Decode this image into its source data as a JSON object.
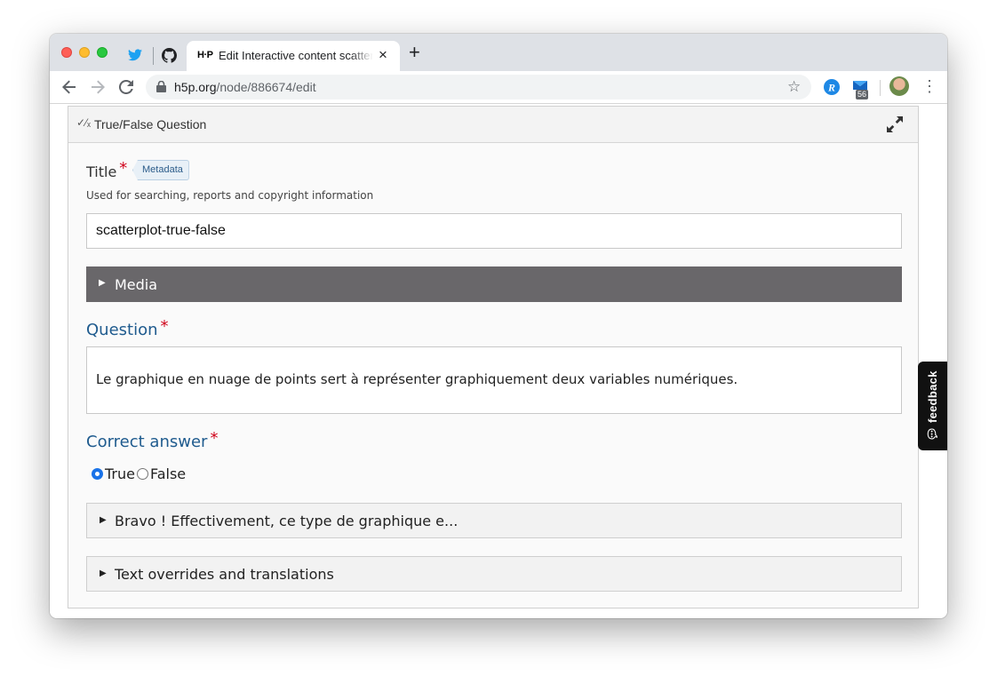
{
  "browser": {
    "tab_favicon": "H·P",
    "tab_title": "Edit Interactive content scatterplot",
    "tab_close": "×",
    "new_tab": "+",
    "url_host": "h5p.org",
    "url_path": "/node/886674/edit",
    "extension_badge": "56",
    "menu": "⋮"
  },
  "editor": {
    "header_title": "True/False Question",
    "header_icon": "✓⁄ₓ",
    "title_label": "Title",
    "required_mark": "*",
    "metadata_button": "Metadata",
    "title_description": "Used for searching, reports and copyright information",
    "title_value": "scatterplot-true-false",
    "media_label": "Media",
    "question_label": "Question",
    "question_value": "Le graphique en nuage de points sert à représenter graphiquement deux variables numériques.",
    "correct_answer_label": "Correct answer",
    "options": {
      "true_label": "True",
      "false_label": "False",
      "selected": "True"
    },
    "feedback_group_label": "Bravo ! Effectivement, ce type de graphique e...",
    "overrides_group_label": "Text overrides and translations"
  },
  "feedback_tab": {
    "label": "feedback"
  },
  "colors": {
    "accent": "#1f5b8e",
    "required": "#d0021b",
    "media_bar": "#69676a",
    "radio": "#1a73e8"
  }
}
